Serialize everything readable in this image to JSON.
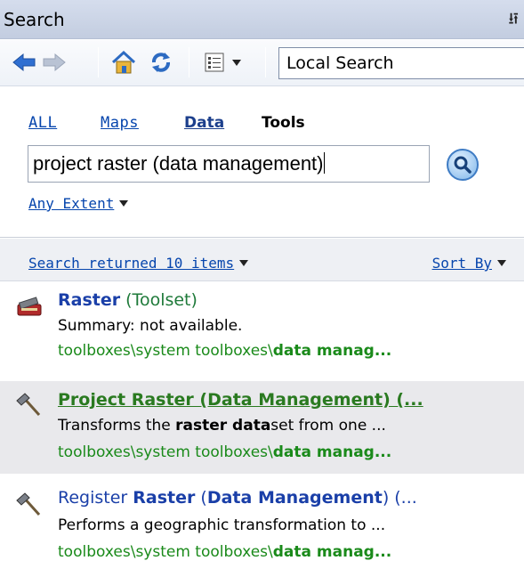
{
  "window": {
    "title": "Search",
    "pin_icon": "pin-icon"
  },
  "toolbar": {
    "buttons": [
      "back-arrow-icon",
      "forward-arrow-icon",
      "home-icon",
      "refresh-icon",
      "view-list-icon"
    ],
    "search_scope": "Local Search"
  },
  "search": {
    "tabs": {
      "all": "ALL",
      "maps": "Maps",
      "data": "Data",
      "tools": "Tools"
    },
    "query": "project raster (data management)",
    "extent": "Any Extent"
  },
  "results": {
    "count_text": "Search returned 10 items",
    "sort_label": "Sort By",
    "items": [
      {
        "title_bold": "Raster",
        "title_rest": " (Toolset)",
        "summary_pre": "Summary: not available.",
        "summary_bold": "",
        "summary_post": "",
        "path_pre": "toolboxes\\system toolboxes\\",
        "path_bold": "data manag..."
      },
      {
        "title_full": "Project Raster (Data Management) (...",
        "summary_pre": "Transforms the ",
        "summary_bold": "raster data",
        "summary_post": "set from one ...",
        "path_pre": "toolboxes\\system toolboxes\\",
        "path_bold": "data manag..."
      },
      {
        "title_pre": "Register ",
        "title_bold1": "Raster",
        "title_mid": " (",
        "title_bold2": "Data Management",
        "title_post": ") (...",
        "summary_pre": "Performs a geographic transformation to ...",
        "path_pre": "toolboxes\\system toolboxes\\",
        "path_bold": "data manag..."
      }
    ]
  },
  "colors": {
    "link_blue": "#0645ad",
    "title_blue": "#1a3fa8",
    "path_green": "#1a8a1a",
    "highlight_row": "#e9e9ec"
  }
}
